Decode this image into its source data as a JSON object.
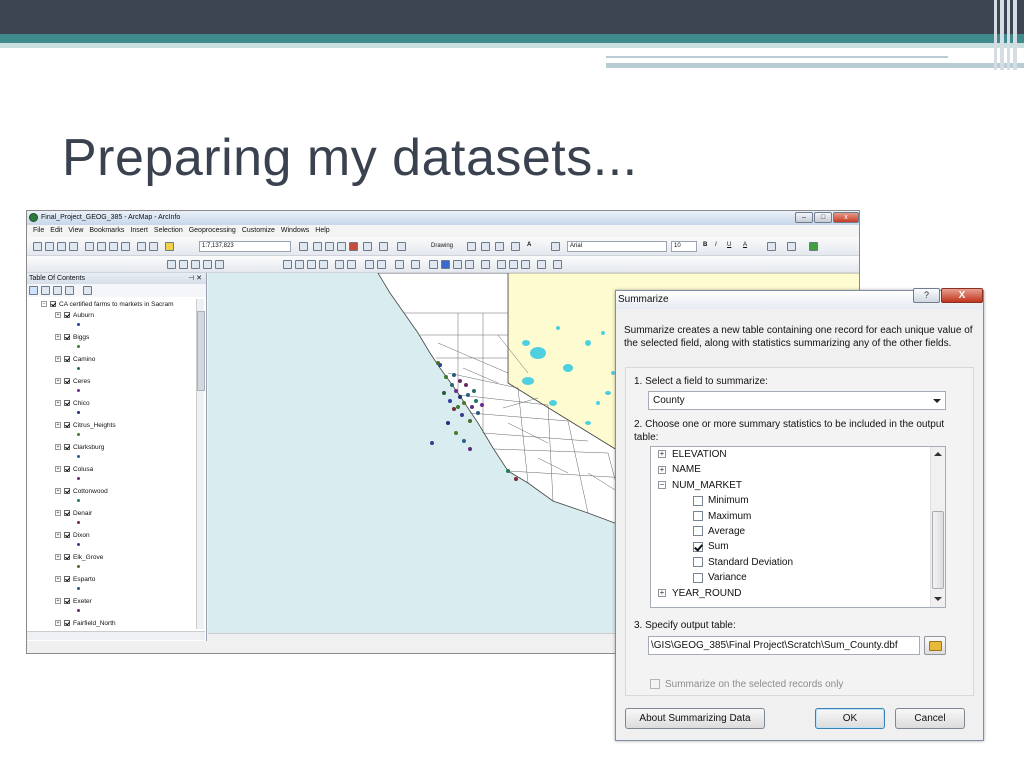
{
  "slide": {
    "title": "Preparing my datasets..."
  },
  "arcmap": {
    "window_title": "Final_Project_GEOG_385 - ArcMap - ArcInfo",
    "menu": [
      "File",
      "Edit",
      "View",
      "Bookmarks",
      "Insert",
      "Selection",
      "Geoprocessing",
      "Customize",
      "Windows",
      "Help"
    ],
    "scale_value": "1:7,137,823",
    "drawing_label": "Drawing",
    "font_name": "Arial",
    "font_size": "10",
    "toc_title": "Table Of Contents",
    "toc_root_layer": "CA certified farms to markets in Sacram",
    "toc_layers": [
      {
        "name": "Auburn",
        "color": "#2a3f9e"
      },
      {
        "name": "Biggs",
        "color": "#3b7d2e"
      },
      {
        "name": "Camino",
        "color": "#2a6a6a"
      },
      {
        "name": "Ceres",
        "color": "#6a2f8f"
      },
      {
        "name": "Chico",
        "color": "#1f2f7a"
      },
      {
        "name": "Citrus_Heights",
        "color": "#4a7a2a"
      },
      {
        "name": "Clarksburg",
        "color": "#2b5e8f"
      },
      {
        "name": "Colusa",
        "color": "#5a2f7a"
      },
      {
        "name": "Cottonwood",
        "color": "#1f7a5a"
      },
      {
        "name": "Denair",
        "color": "#7a2a3a"
      },
      {
        "name": "Dixon",
        "color": "#3b3b8f"
      },
      {
        "name": "Elk_Grove",
        "color": "#4a6a2a"
      },
      {
        "name": "Esparto",
        "color": "#2a5a7a"
      },
      {
        "name": "Exeter",
        "color": "#6a2a6a"
      },
      {
        "name": "Fairfield_North",
        "color": "#1f5e3a"
      }
    ],
    "colors": {
      "ocean": "#d9ecef",
      "land": "#ffffff",
      "nevada": "#fffbd0",
      "lakes": "#4fd0e0"
    }
  },
  "dialog": {
    "title": "Summarize",
    "help_label": "?",
    "close_label": "X",
    "description": "Summarize creates a new table containing one record for each unique value of the selected field, along with statistics summarizing any of the other fields.",
    "step1_label": "1.  Select a field to summarize:",
    "field_value": "County",
    "step2_label": "2.  Choose one or more summary statistics to be included in the output table:",
    "tree": [
      {
        "type": "field",
        "label": "ELEVATION",
        "expander": "+"
      },
      {
        "type": "field",
        "label": "NAME",
        "expander": "+"
      },
      {
        "type": "field",
        "label": "NUM_MARKET",
        "expander": "−"
      },
      {
        "type": "stat",
        "label": "Minimum",
        "checked": false
      },
      {
        "type": "stat",
        "label": "Maximum",
        "checked": false
      },
      {
        "type": "stat",
        "label": "Average",
        "checked": false
      },
      {
        "type": "stat",
        "label": "Sum",
        "checked": true
      },
      {
        "type": "stat",
        "label": "Standard Deviation",
        "checked": false
      },
      {
        "type": "stat",
        "label": "Variance",
        "checked": false
      },
      {
        "type": "field",
        "label": "YEAR_ROUND",
        "expander": "+"
      }
    ],
    "step3_label": "3.  Specify output table:",
    "output_path": "\\GIS\\GEOG_385\\Final Project\\Scratch\\Sum_County.dbf",
    "selected_only_label": "Summarize on the selected records only",
    "about_button": "About Summarizing Data",
    "ok_button": "OK",
    "cancel_button": "Cancel"
  }
}
